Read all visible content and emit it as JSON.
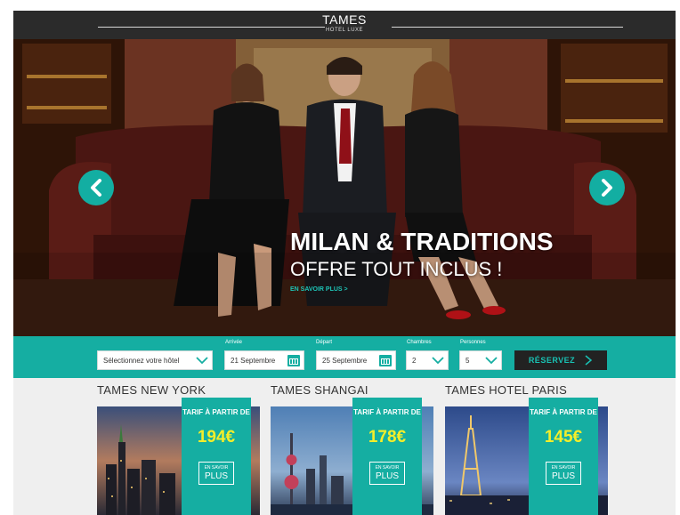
{
  "header": {
    "brand": "TAMES",
    "tagline": "HOTEL LUXE"
  },
  "hero": {
    "title": "MILAN & TRADITIONS",
    "subtitle": "OFFRE TOUT INCLUS !",
    "link": "EN SAVOIR PLUS >",
    "prev_icon": "chevron-left-icon",
    "next_icon": "chevron-right-icon"
  },
  "booking": {
    "hotel_select": "Sélectionnez votre hôtel",
    "arrival_label": "Arrivée",
    "arrival_value": "21 Septembre",
    "departure_label": "Départ",
    "departure_value": "25 Septembre",
    "rooms_label": "Chambres",
    "rooms_value": "2",
    "persons_label": "Personnes",
    "persons_value": "5",
    "reserve_label": "RÉSERVEZ",
    "reserve_icon": "chevron-right-icon"
  },
  "hotels": [
    {
      "name": "TAMES NEW YORK",
      "tarif": "TARIF À PARTIR DE",
      "price": "194€",
      "more_small": "EN SAVOIR",
      "more_big": "PLUS"
    },
    {
      "name": "TAMES SHANGAI",
      "tarif": "TARIF À PARTIR DE",
      "price": "178€",
      "more_small": "EN SAVOIR",
      "more_big": "PLUS"
    },
    {
      "name": "TAMES HOTEL PARIS",
      "tarif": "TARIF À PARTIR DE",
      "price": "145€",
      "more_small": "EN SAVOIR",
      "more_big": "PLUS"
    }
  ],
  "colors": {
    "teal": "#15aea2",
    "header": "#2b2b2b",
    "price": "#f4ee2a",
    "reserve_bg": "#222222"
  }
}
